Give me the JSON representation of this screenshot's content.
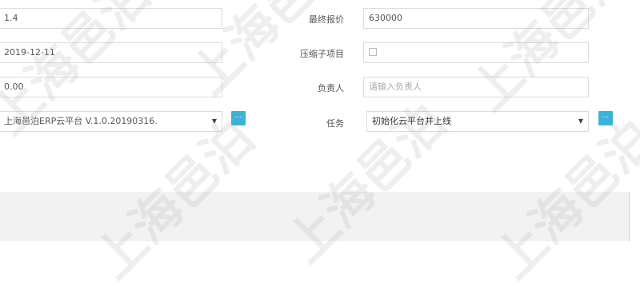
{
  "left_fields": [
    {
      "value": "1.4"
    },
    {
      "value": "2019-12-11"
    },
    {
      "value": "0.00"
    },
    {
      "value": "上海邑泊ERP云平台 V.1.0.20190316."
    }
  ],
  "right_fields": [
    {
      "label": "最终报价",
      "value": "630000"
    },
    {
      "label": "压缩子项目",
      "value": ""
    },
    {
      "label": "负责人",
      "placeholder": "请输入负责人"
    },
    {
      "label": "任务",
      "value": "初始化云平台并上线"
    }
  ],
  "buttons": {
    "dots": "..."
  },
  "icons": {
    "caret": "▼"
  },
  "watermark": "上海邑泊"
}
